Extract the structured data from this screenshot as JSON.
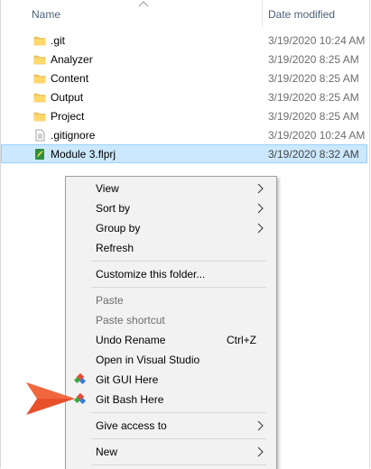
{
  "columns": {
    "name": "Name",
    "date_modified": "Date modified"
  },
  "files": [
    {
      "name": ".git",
      "date": "3/19/2020 10:24 AM",
      "icon": "folder-icon"
    },
    {
      "name": "Analyzer",
      "date": "3/19/2020 8:25 AM",
      "icon": "folder-icon"
    },
    {
      "name": "Content",
      "date": "3/19/2020 8:25 AM",
      "icon": "folder-icon"
    },
    {
      "name": "Output",
      "date": "3/19/2020 8:25 AM",
      "icon": "folder-icon"
    },
    {
      "name": "Project",
      "date": "3/19/2020 8:25 AM",
      "icon": "folder-icon"
    },
    {
      "name": ".gitignore",
      "date": "3/19/2020 10:24 AM",
      "icon": "text-file-icon"
    },
    {
      "name": "Module 3.flprj",
      "date": "3/19/2020 8:32 AM",
      "icon": "flprj-file-icon",
      "selected": true
    }
  ],
  "context_menu": {
    "view": "View",
    "sort_by": "Sort by",
    "group_by": "Group by",
    "refresh": "Refresh",
    "customize": "Customize this folder...",
    "paste": "Paste",
    "paste_shortcut": "Paste shortcut",
    "undo_rename": "Undo Rename",
    "undo_rename_shortcut": "Ctrl+Z",
    "open_vs": "Open in Visual Studio",
    "git_gui": "Git GUI Here",
    "git_bash": "Git Bash Here",
    "give_access": "Give access to",
    "new": "New"
  },
  "colors": {
    "folder": "#f0c75e",
    "selection": "#cce8ff",
    "menu_bg": "#f2f2f2",
    "pointer_arrow": "#e8502a"
  }
}
